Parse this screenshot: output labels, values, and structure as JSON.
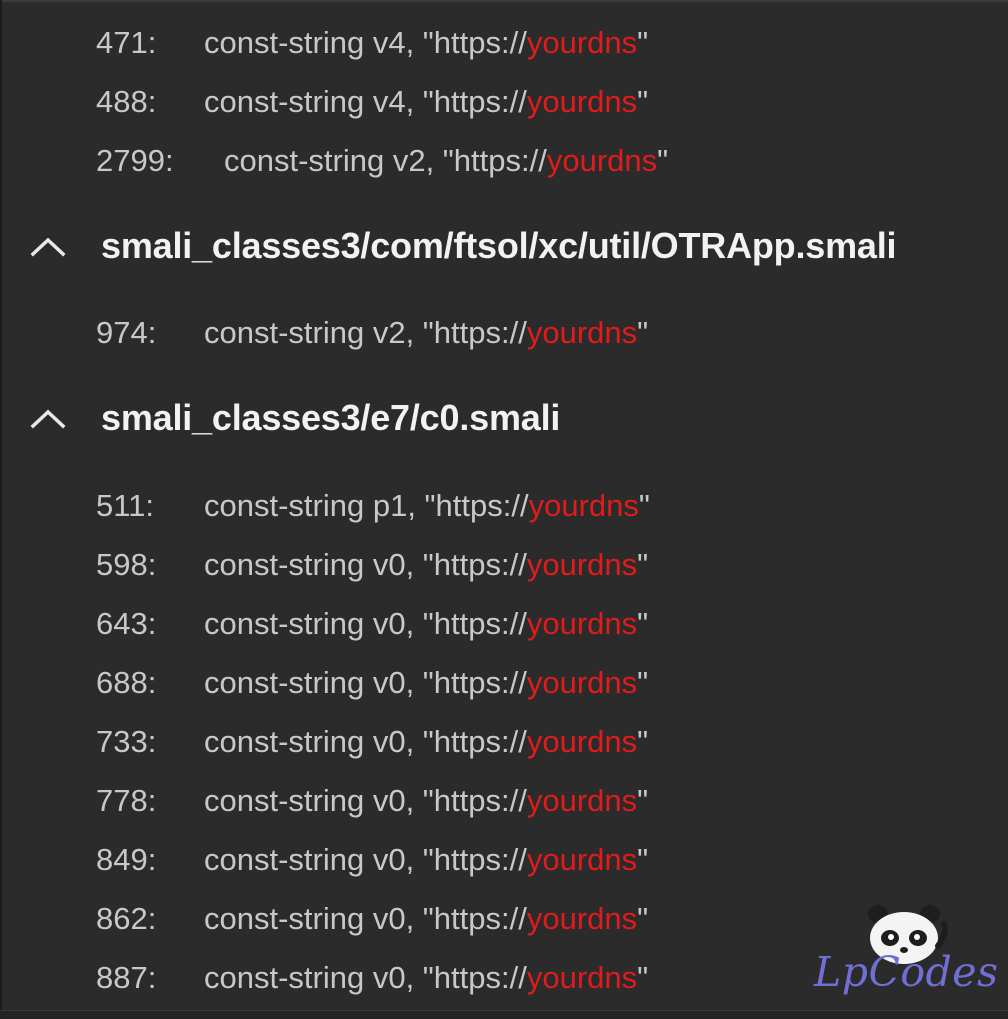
{
  "results": {
    "top_rows": [
      {
        "line": "471:",
        "code": "const-string v4, \"https://",
        "match": "yourdns",
        "tail": "\""
      },
      {
        "line": "488:",
        "code": "const-string v4, \"https://",
        "match": "yourdns",
        "tail": "\""
      },
      {
        "line": "2799:",
        "code": "const-string v2, \"https://",
        "match": "yourdns",
        "tail": "\""
      }
    ],
    "groups": [
      {
        "path": "smali_classes3/com/ftsol/xc/util/OTRApp.smali",
        "rows": [
          {
            "line": "974:",
            "code": "const-string v2, \"https://",
            "match": "yourdns",
            "tail": "\""
          }
        ]
      },
      {
        "path": "smali_classes3/e7/c0.smali",
        "rows": [
          {
            "line": "511:",
            "code": "const-string p1, \"https://",
            "match": "yourdns",
            "tail": "\""
          },
          {
            "line": "598:",
            "code": "const-string v0, \"https://",
            "match": "yourdns",
            "tail": "\""
          },
          {
            "line": "643:",
            "code": "const-string v0, \"https://",
            "match": "yourdns",
            "tail": "\""
          },
          {
            "line": "688:",
            "code": "const-string v0, \"https://",
            "match": "yourdns",
            "tail": "\""
          },
          {
            "line": "733:",
            "code": "const-string v0, \"https://",
            "match": "yourdns",
            "tail": "\""
          },
          {
            "line": "778:",
            "code": "const-string v0, \"https://",
            "match": "yourdns",
            "tail": "\""
          },
          {
            "line": "849:",
            "code": "const-string v0, \"https://",
            "match": "yourdns",
            "tail": "\""
          },
          {
            "line": "862:",
            "code": "const-string v0, \"https://",
            "match": "yourdns",
            "tail": "\""
          },
          {
            "line": "887:",
            "code": "const-string v0, \"https://",
            "match": "yourdns",
            "tail": "\""
          }
        ]
      }
    ]
  },
  "watermark": {
    "text": "LpCodes",
    "icon": "panda-mascot-icon"
  },
  "colors": {
    "background": "#2b2b2b",
    "text": "#c8c8c8",
    "header_text": "#f2f2f2",
    "match_highlight": "#e01b1b",
    "watermark": "#6f6fd6"
  }
}
